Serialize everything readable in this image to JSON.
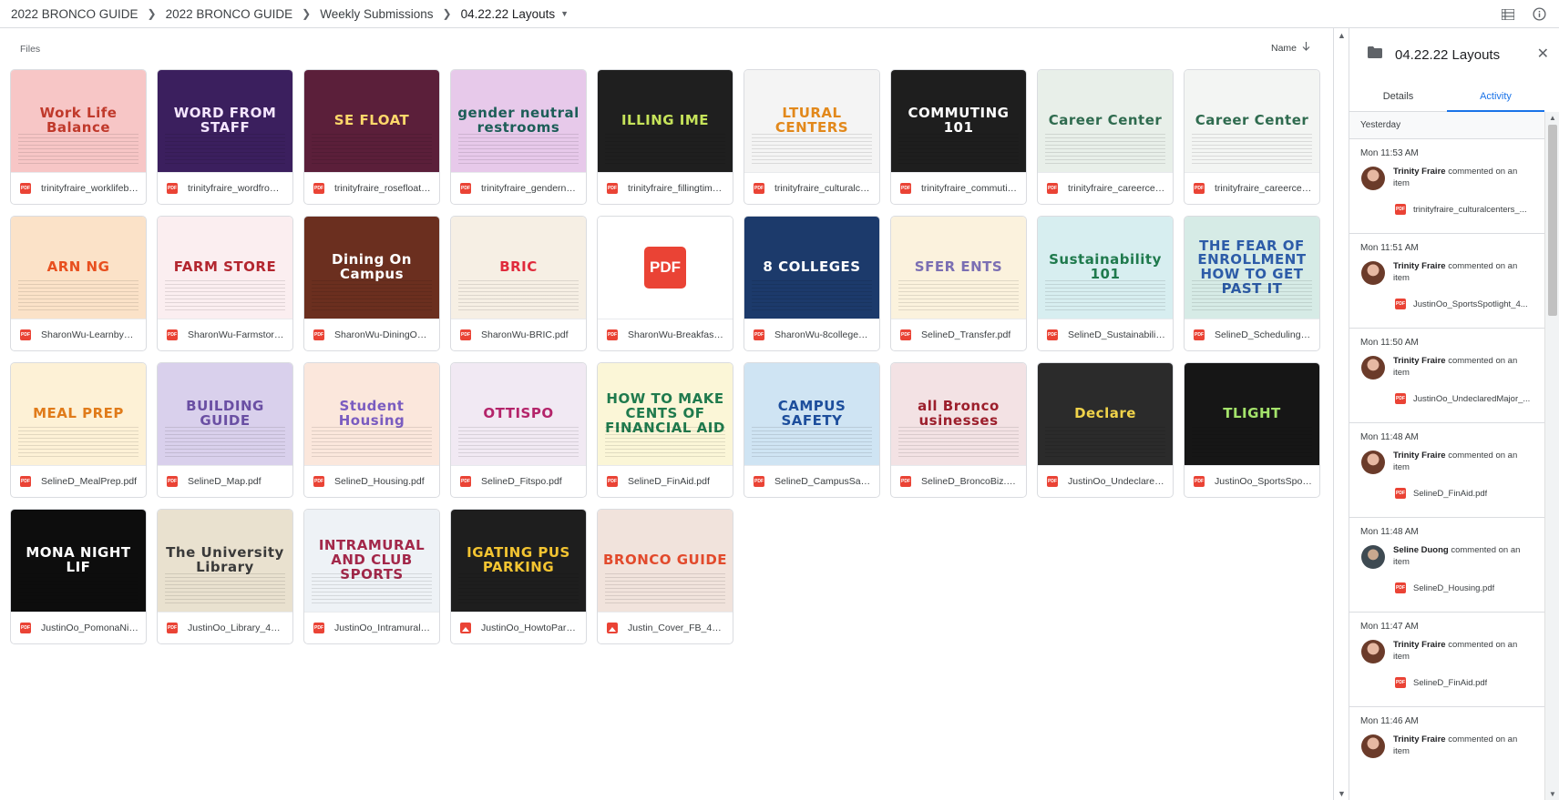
{
  "breadcrumb": {
    "items": [
      "2022 BRONCO GUIDE",
      "2022 BRONCO GUIDE",
      "Weekly Submissions"
    ],
    "current": "04.22.22 Layouts"
  },
  "icons": {
    "list_view": "list-view-icon",
    "info": "info-icon",
    "folder": "folder-icon",
    "close": "close-icon",
    "sort_arrow": "arrow-down-icon"
  },
  "files": {
    "label": "Files",
    "sort_label": "Name",
    "items": [
      {
        "name": "trinityfraire_worklifebal...",
        "type": "pdf",
        "thumb_title": "Work Life Balance",
        "bg": "#f7c6c6",
        "fg": "#c0392b"
      },
      {
        "name": "trinityfraire_wordfroms...",
        "type": "pdf",
        "thumb_title": "WORD FROM STAFF",
        "bg": "#3b1f5e",
        "fg": "#f5e6ff"
      },
      {
        "name": "trinityfraire_rosefloat_v...",
        "type": "pdf",
        "thumb_title": "SE FLOAT",
        "bg": "#5b1f3a",
        "fg": "#ffd86b"
      },
      {
        "name": "trinityfraire_gendernetu...",
        "type": "pdf",
        "thumb_title": "gender neutral restrooms",
        "bg": "#e7c9ea",
        "fg": "#1d5e58"
      },
      {
        "name": "trinityfraire_fillingtime_...",
        "type": "pdf",
        "thumb_title": "ILLING IME",
        "bg": "#1f1f1f",
        "fg": "#c6e35a"
      },
      {
        "name": "trinityfraire_culturalcen...",
        "type": "pdf",
        "thumb_title": "LTURAL CENTERS",
        "bg": "#f4f4f4",
        "fg": "#e2881b"
      },
      {
        "name": "trinityfraire_commuting...",
        "type": "pdf",
        "thumb_title": "COMMUTING 101",
        "bg": "#1e1e1e",
        "fg": "#ffffff"
      },
      {
        "name": "trinityfraire_careercent...",
        "type": "pdf",
        "thumb_title": "Career Center",
        "bg": "#e8efe9",
        "fg": "#2f6b4f"
      },
      {
        "name": "trinityfraire_careercent...",
        "type": "pdf",
        "thumb_title": "Career Center",
        "bg": "#f3f5f3",
        "fg": "#2f6b4f"
      },
      {
        "name": "SharonWu-LearnbyDoin...",
        "type": "pdf",
        "thumb_title": "ARN NG",
        "bg": "#fbe2c8",
        "fg": "#e8501f"
      },
      {
        "name": "SharonWu-Farmstore.p...",
        "type": "pdf",
        "thumb_title": "FARM STORE",
        "bg": "#fbeef0",
        "fg": "#b3262f"
      },
      {
        "name": "SharonWu-DiningOnCa...",
        "type": "pdf",
        "thumb_title": "Dining On Campus",
        "bg": "#6b2f1f",
        "fg": "#ffffff"
      },
      {
        "name": "SharonWu-BRIC.pdf",
        "type": "pdf",
        "thumb_title": "BRIC",
        "bg": "#f6efe4",
        "fg": "#e02b3c"
      },
      {
        "name": "SharonWu-BreakfastGu...",
        "type": "pdf",
        "thumb_title": "",
        "bg": "#ffffff",
        "fg": "#ea4335",
        "big_pdf": "PDF"
      },
      {
        "name": "SharonWu-8colleges.pdf",
        "type": "pdf",
        "thumb_title": "8 COLLEGES",
        "bg": "#1c3a6b",
        "fg": "#ffffff"
      },
      {
        "name": "SelineD_Transfer.pdf",
        "type": "pdf",
        "thumb_title": "SFER ENTS",
        "bg": "#fbf2dd",
        "fg": "#7b6fb3"
      },
      {
        "name": "SelineD_Sustainability....",
        "type": "pdf",
        "thumb_title": "Sustainability 101",
        "bg": "#d7eef0",
        "fg": "#1f7a4d"
      },
      {
        "name": "SelineD_Scheduling.pdf",
        "type": "pdf",
        "thumb_title": "THE FEAR OF ENROLLMENT HOW TO GET PAST IT",
        "bg": "#d6ebe6",
        "fg": "#2d5ca8"
      },
      {
        "name": "SelineD_MealPrep.pdf",
        "type": "pdf",
        "thumb_title": "MEAL PREP",
        "bg": "#fdf1d6",
        "fg": "#e07b1a"
      },
      {
        "name": "SelineD_Map.pdf",
        "type": "pdf",
        "thumb_title": "BUILDING GUIDE",
        "bg": "#d9d0ec",
        "fg": "#6a4fa3"
      },
      {
        "name": "SelineD_Housing.pdf",
        "type": "pdf",
        "thumb_title": "Student Housing",
        "bg": "#fbe7dc",
        "fg": "#7a5cc0"
      },
      {
        "name": "SelineD_Fitspo.pdf",
        "type": "pdf",
        "thumb_title": "OTTISPO",
        "bg": "#f1e9f3",
        "fg": "#b4246a"
      },
      {
        "name": "SelineD_FinAid.pdf",
        "type": "pdf",
        "thumb_title": "HOW TO MAKE CENTS OF FINANCIAL AID",
        "bg": "#fbf6d7",
        "fg": "#1f7a4d"
      },
      {
        "name": "SelineD_CampusSafety...",
        "type": "pdf",
        "thumb_title": "CAMPUS SAFETY",
        "bg": "#cfe4f3",
        "fg": "#1d4e9c"
      },
      {
        "name": "SelineD_BroncoBiz.pdf",
        "type": "pdf",
        "thumb_title": "all Bronco usinesses",
        "bg": "#f3e2e4",
        "fg": "#9c1f2c"
      },
      {
        "name": "JustinOo_UndeclaredM...",
        "type": "pdf",
        "thumb_title": "Declare",
        "bg": "#2b2b2b",
        "fg": "#f0d34a"
      },
      {
        "name": "JustinOo_SportsSpotli...",
        "type": "pdf",
        "thumb_title": "TLIGHT",
        "bg": "#161616",
        "fg": "#a4e36b"
      },
      {
        "name": "JustinOo_PomonaNigh...",
        "type": "pdf",
        "thumb_title": "MONA NIGHT LIF",
        "bg": "#0d0d0d",
        "fg": "#ffffff"
      },
      {
        "name": "JustinOo_Library_4_18....",
        "type": "pdf",
        "thumb_title": "The University Library",
        "bg": "#e9e1cf",
        "fg": "#3a3a3a"
      },
      {
        "name": "JustinOo_IntramuralAn...",
        "type": "pdf",
        "thumb_title": "INTRAMURAL AND CLUB SPORTS",
        "bg": "#eef2f6",
        "fg": "#a3284a"
      },
      {
        "name": "JustinOo_HowtoPark_4...",
        "type": "img",
        "thumb_title": "IGATING PUS PARKING",
        "bg": "#1e1e1e",
        "fg": "#f3c431"
      },
      {
        "name": "Justin_Cover_FB_4_18....",
        "type": "img",
        "thumb_title": "BRONCO GUIDE",
        "bg": "#f1e3dc",
        "fg": "#e24a2c"
      }
    ]
  },
  "panel": {
    "title": "04.22.22 Layouts",
    "tabs": [
      {
        "label": "Details",
        "active": false
      },
      {
        "label": "Activity",
        "active": true
      }
    ],
    "day_label": "Yesterday",
    "activity": [
      {
        "time": "Mon 11:53 AM",
        "user": "Trinity Fraire",
        "action": "commented on an item",
        "file": "trinityfraire_culturalcenters_...",
        "avatar": "a"
      },
      {
        "time": "Mon 11:51 AM",
        "user": "Trinity Fraire",
        "action": "commented on an item",
        "file": "JustinOo_SportsSpotlight_4...",
        "avatar": "a"
      },
      {
        "time": "Mon 11:50 AM",
        "user": "Trinity Fraire",
        "action": "commented on an item",
        "file": "JustinOo_UndeclaredMajor_...",
        "avatar": "a"
      },
      {
        "time": "Mon 11:48 AM",
        "user": "Trinity Fraire",
        "action": "commented on an item",
        "file": "SelineD_FinAid.pdf",
        "avatar": "a"
      },
      {
        "time": "Mon 11:48 AM",
        "user": "Seline Duong",
        "action": "commented on an item",
        "file": "SelineD_Housing.pdf",
        "avatar": "b"
      },
      {
        "time": "Mon 11:47 AM",
        "user": "Trinity Fraire",
        "action": "commented on an item",
        "file": "SelineD_FinAid.pdf",
        "avatar": "a"
      },
      {
        "time": "Mon 11:46 AM",
        "user": "Trinity Fraire",
        "action": "commented on an item",
        "file": "",
        "avatar": "a"
      }
    ]
  },
  "colors": {
    "accent": "#1a73e8",
    "pdf_red": "#ea4335",
    "border": "#dadce0"
  }
}
